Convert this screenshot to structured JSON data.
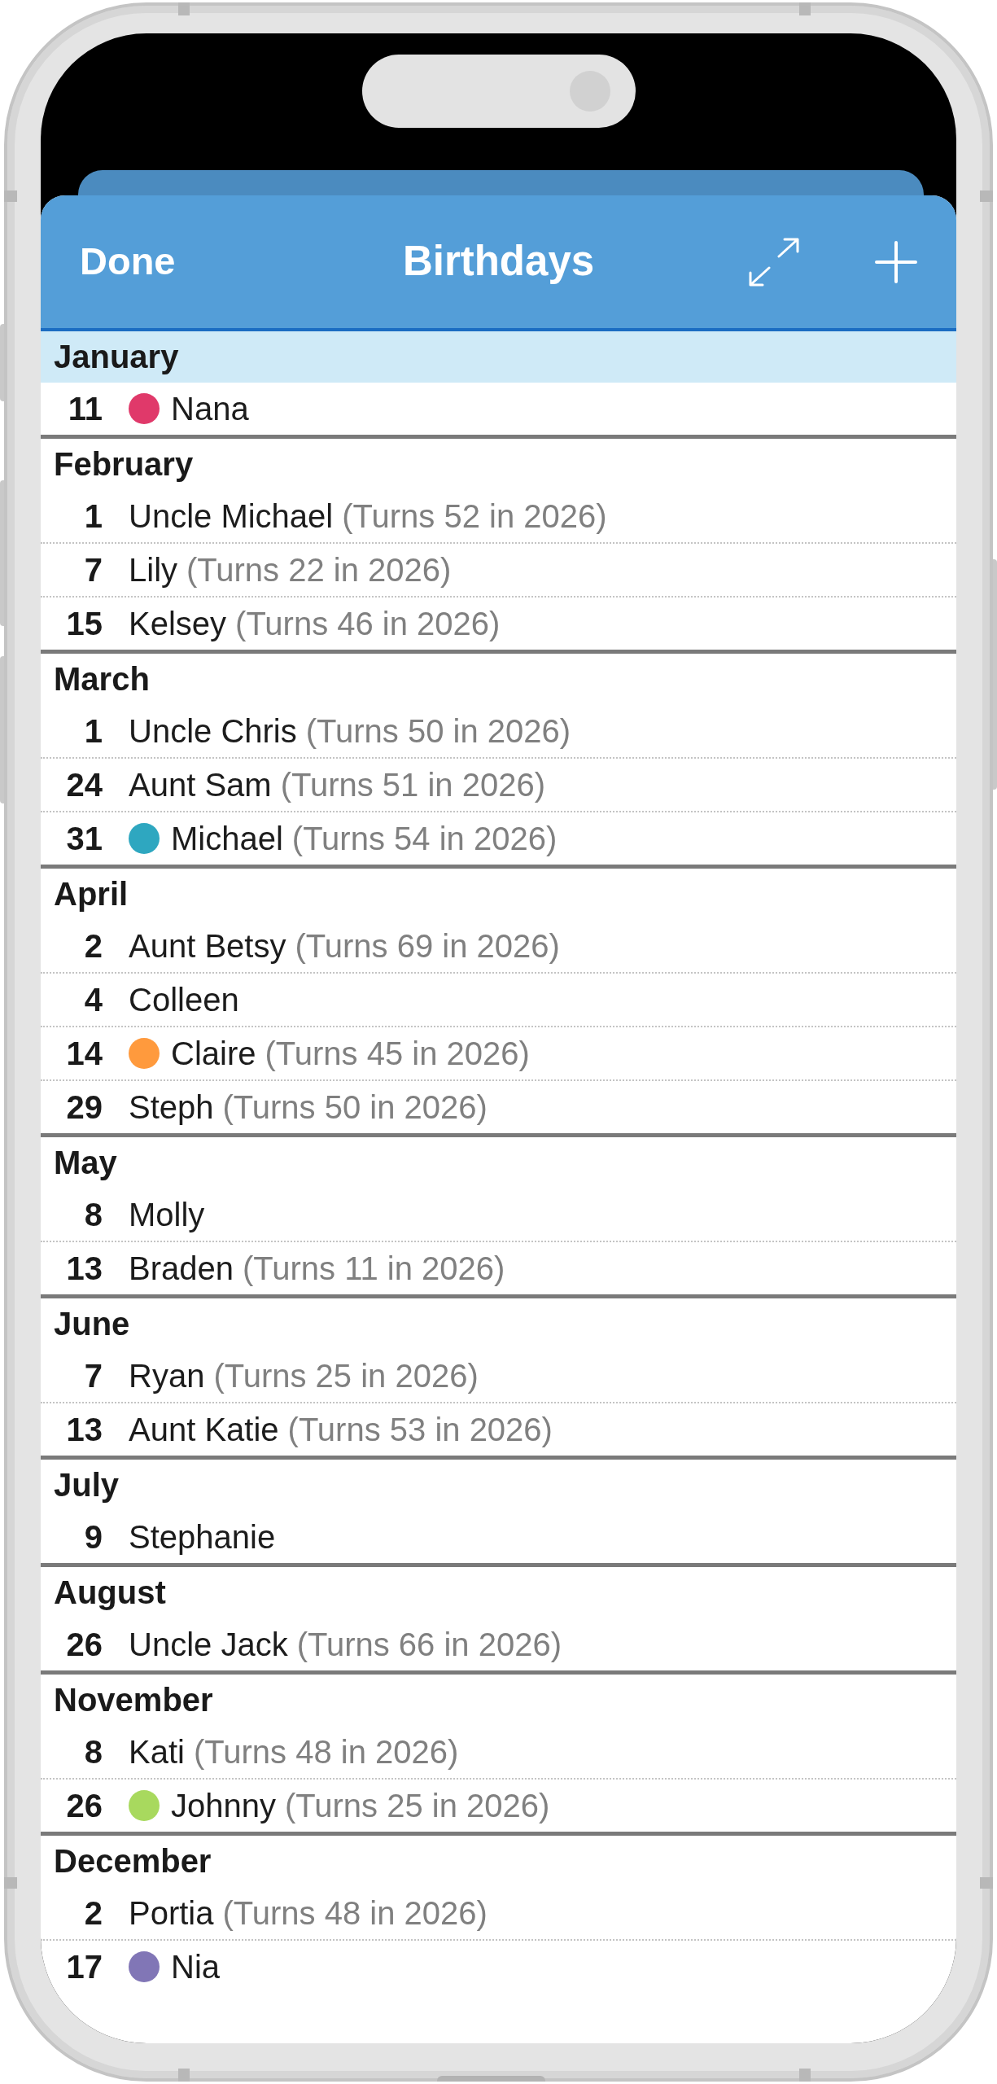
{
  "header": {
    "left_button": "Done",
    "title": "Birthdays"
  },
  "months": [
    {
      "name": "January",
      "highlighted": true,
      "people": [
        {
          "day": "11",
          "name": "Nana",
          "color": "#e0396a"
        }
      ]
    },
    {
      "name": "February",
      "highlighted": false,
      "people": [
        {
          "day": "1",
          "name": "Uncle Michael",
          "note": "(Turns 52 in 2026)"
        },
        {
          "day": "7",
          "name": "Lily",
          "note": "(Turns 22 in 2026)"
        },
        {
          "day": "15",
          "name": "Kelsey",
          "note": "(Turns 46 in 2026)"
        }
      ]
    },
    {
      "name": "March",
      "highlighted": false,
      "people": [
        {
          "day": "1",
          "name": "Uncle Chris",
          "note": "(Turns 50 in 2026)"
        },
        {
          "day": "24",
          "name": "Aunt Sam",
          "note": "(Turns 51 in 2026)"
        },
        {
          "day": "31",
          "name": "Michael",
          "color": "#2ea7c0",
          "note": "(Turns 54 in 2026)"
        }
      ]
    },
    {
      "name": "April",
      "highlighted": false,
      "people": [
        {
          "day": "2",
          "name": "Aunt Betsy",
          "note": "(Turns 69 in 2026)"
        },
        {
          "day": "4",
          "name": "Colleen"
        },
        {
          "day": "14",
          "name": "Claire",
          "color": "#ff9a3d",
          "note": "(Turns 45 in 2026)"
        },
        {
          "day": "29",
          "name": "Steph",
          "note": "(Turns 50 in 2026)"
        }
      ]
    },
    {
      "name": "May",
      "highlighted": false,
      "people": [
        {
          "day": "8",
          "name": "Molly"
        },
        {
          "day": "13",
          "name": "Braden",
          "note": "(Turns 11 in 2026)"
        }
      ]
    },
    {
      "name": "June",
      "highlighted": false,
      "people": [
        {
          "day": "7",
          "name": "Ryan",
          "note": "(Turns 25 in 2026)"
        },
        {
          "day": "13",
          "name": "Aunt Katie",
          "note": "(Turns 53 in 2026)"
        }
      ]
    },
    {
      "name": "July",
      "highlighted": false,
      "people": [
        {
          "day": "9",
          "name": "Stephanie"
        }
      ]
    },
    {
      "name": "August",
      "highlighted": false,
      "people": [
        {
          "day": "26",
          "name": "Uncle Jack",
          "note": "(Turns 66 in 2026)"
        }
      ]
    },
    {
      "name": "November",
      "highlighted": false,
      "people": [
        {
          "day": "8",
          "name": "Kati",
          "note": "(Turns 48 in 2026)"
        },
        {
          "day": "26",
          "name": "Johnny",
          "color": "#a8d95e",
          "note": "(Turns 25 in 2026)"
        }
      ]
    },
    {
      "name": "December",
      "highlighted": false,
      "people": [
        {
          "day": "2",
          "name": "Portia",
          "note": "(Turns 48 in 2026)"
        },
        {
          "day": "17",
          "name": "Nia",
          "color": "#8176b6"
        }
      ]
    }
  ]
}
